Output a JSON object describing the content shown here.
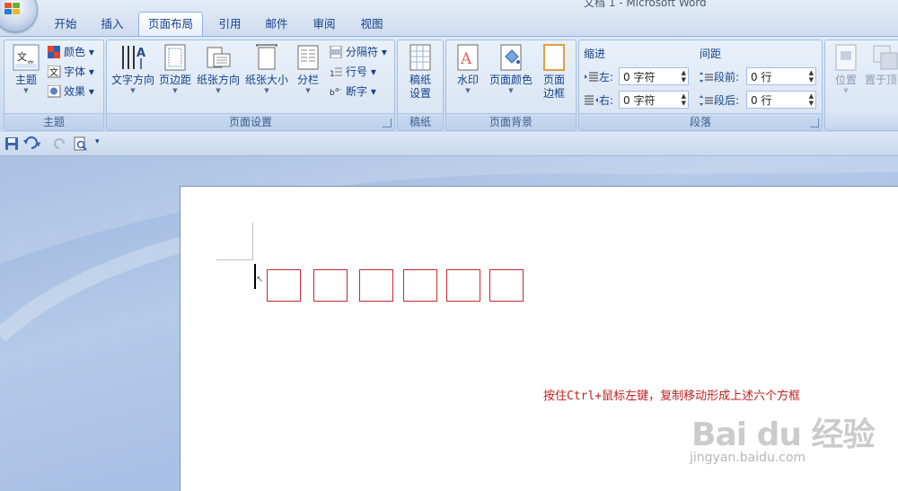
{
  "window": {
    "title": "文档 1 - Microsoft Word"
  },
  "tabs": [
    "开始",
    "插入",
    "页面布局",
    "引用",
    "邮件",
    "审阅",
    "视图"
  ],
  "active_tab": "页面布局",
  "ribbon": {
    "theme_group": {
      "label": "主题",
      "themes_button": "主题",
      "colors": "颜色",
      "fonts": "字体",
      "effects": "效果"
    },
    "page_setup": {
      "label": "页面设置",
      "text_direction": "文字方向",
      "margins": "页边距",
      "orientation": "纸张方向",
      "size": "纸张大小",
      "columns": "分栏",
      "breaks": "分隔符",
      "line_numbers": "行号",
      "hyphenation": "断字"
    },
    "manuscript": {
      "label": "稿纸",
      "setup_line1": "稿纸",
      "setup_line2": "设置"
    },
    "page_background": {
      "label": "页面背景",
      "watermark": "水印",
      "page_color": "页面颜色",
      "page_borders_line1": "页面",
      "page_borders_line2": "边框"
    },
    "paragraph": {
      "label": "段落",
      "indent_header": "缩进",
      "indent_left_label": "左:",
      "indent_left_value": "0 字符",
      "indent_right_label": "右:",
      "indent_right_value": "0 字符",
      "spacing_header": "间距",
      "spacing_before_label": "段前:",
      "spacing_before_value": "0 行",
      "spacing_after_label": "段后:",
      "spacing_after_value": "0 行"
    },
    "arrange": {
      "position": "位置",
      "bring_to_front": "置于顶"
    }
  },
  "document": {
    "annotation": "按住Ctrl+鼠标左键，复制移动形成上述六个方框",
    "box_count": 6
  },
  "watermark": {
    "brand": "Bai du 经验",
    "url": "jingyan.baidu.com"
  },
  "colors": {
    "annotation": "#c0201f",
    "box_border": "#c8282d",
    "ribbon_text": "#15428b"
  }
}
